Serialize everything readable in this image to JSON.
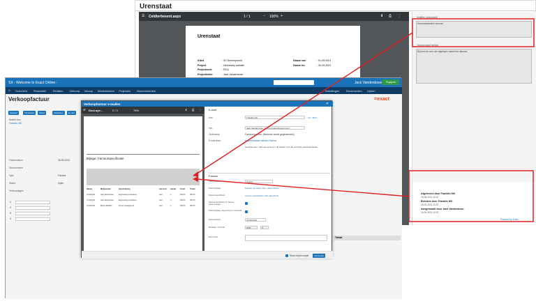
{
  "urenstaat": {
    "title": "Urenstaat",
    "pdf_filename": "Celdterbesent.aspx",
    "pdf_page": "1 / 1",
    "pdf_zoom": "100%",
    "doc_title": "Urenstaat",
    "fields": [
      {
        "label": "Klant",
        "value": ": SX Development"
      },
      {
        "label": "Project",
        "value": ": Hennewey website"
      },
      {
        "label": "Projectcode",
        "value": ": P011"
      },
      {
        "label": "Projectleider",
        "value": ": Jack Vandenbose"
      },
      {
        "label": "PO nummer",
        "value": ": RK-12312012"
      }
    ],
    "dates": [
      {
        "label": "Datum van",
        "value": ": 01-09-2021"
      },
      {
        "label": "Datum tm.",
        "value": ": 30-09-2021"
      }
    ],
    "notes_label": "Notities (optioneel)",
    "notes_value": "Hennweerweeten eenoom",
    "toegevoegd_label": "Toegevoegd bericht",
    "toegevoegd_value": "Bij deze de uren van afgelopen maand ter akkoord",
    "approvals": [
      {
        "label": "Afgeleverd door Franklin Hill",
        "date": "16-09-2021 12:14"
      },
      {
        "label": "Bekeken door Franklin Hill",
        "date": "16-09-2021 12:22"
      },
      {
        "label": "Aangemaakt door Jack Vandenbose",
        "date": "16-09-2021 12:13"
      }
    ],
    "powered": "Powered by Exact"
  },
  "exact": {
    "window_title": "SX - Welcome to Exact Online -",
    "nav_items": [
      "Overzicht",
      "Financieel",
      "Relaties",
      "Verkoop",
      "Inkoop",
      "Medewerkers",
      "Projecten",
      "Abonnementen"
    ],
    "nav_right": [
      "Instellingen",
      "Documenten",
      "Lijsten"
    ],
    "logo": "=exact",
    "page_title": "Verkoopfactuur",
    "tabs": [
      "Opslaan",
      "Verzenden",
      "Nieuw",
      "Afdrukken",
      "E-mail"
    ],
    "contact_label": "Bestelt door",
    "contact_name": "Franklin Hill",
    "left_labels": [
      "Factuurdatum",
      "Ordernummer",
      "Type",
      "Status",
      "Verkoopdagen"
    ],
    "left_values": [
      "16-09-2021",
      "",
      "Factuur",
      "Open",
      ""
    ],
    "row_numbers": [
      "1",
      "2",
      "3",
      "4"
    ],
    "total_label": "Totaal",
    "user": "Jack Vandenbose",
    "support": "Support"
  },
  "modal": {
    "title": "Verkoopfactuur e-mailen",
    "pdf_filename": "DocLaye...",
    "pdf_page": "2 / 3",
    "pdf_zoom": "75%",
    "pdf_heading": "Bijlage: Factuurspecificatie",
    "pdf_table_headers": [
      "Datum",
      "Medewerker",
      "Omschrijving",
      "Uursoort",
      "Aantal",
      "Tarief",
      "Totaal"
    ],
    "pdf_table_rows": [
      [
        "15-09-2021",
        "Jack Vandenbose",
        "Engineering consultancy",
        "uren",
        "2",
        "100,00",
        "200,00"
      ],
      [
        "17-09-2021",
        "Jack Vandenbose",
        "Engineering consultancy",
        "uren",
        "3",
        "100,00",
        "300,00"
      ],
      [
        "21-09-2021",
        "Bianca Baldwin",
        "Project management",
        "uren",
        "2",
        "100,00",
        "200,00"
      ]
    ],
    "email_section": "E-mail",
    "email_labels": [
      "Aan",
      "Van",
      "Onderwerp",
      "E-mail tekst"
    ],
    "email_to": "Franklin Hill",
    "email_cc": "CC / BCC",
    "email_from": "Jack Vandenbose <henny.invoice@exact.com>",
    "email_subject": "Factuurnummer: (Nummer wordt gegenereerd)",
    "email_attach": "Koppelbestand instellen Factuur",
    "email_body": "Geachte heer, Hiermee stuur ik u de factuur voor de verrichte werkzaamheden.",
    "factuur_section": "Factuur",
    "factuur_labels": [
      "Factuurlayout",
      "Factuurbijlage",
      "Factuurspecificatie",
      "Factuurspecificatie en factuur samenvoegen",
      "Factuurbijlage uitgeprint per urenstaat",
      "Factuurdatum",
      "Boekjaar / Periode",
      "Extra tekst"
    ],
    "factuur_layout": "Project",
    "factuur_bijlage": "Factuur per week met + datumstaten",
    "factuur_spec": "Invoice specification with signoff link",
    "factuur_datum": "16-09-2021",
    "factuur_jaar": "2021",
    "factuur_periode": "9",
    "footer_check": "Stuur mij een kopie",
    "send_button": "Verzenden"
  }
}
